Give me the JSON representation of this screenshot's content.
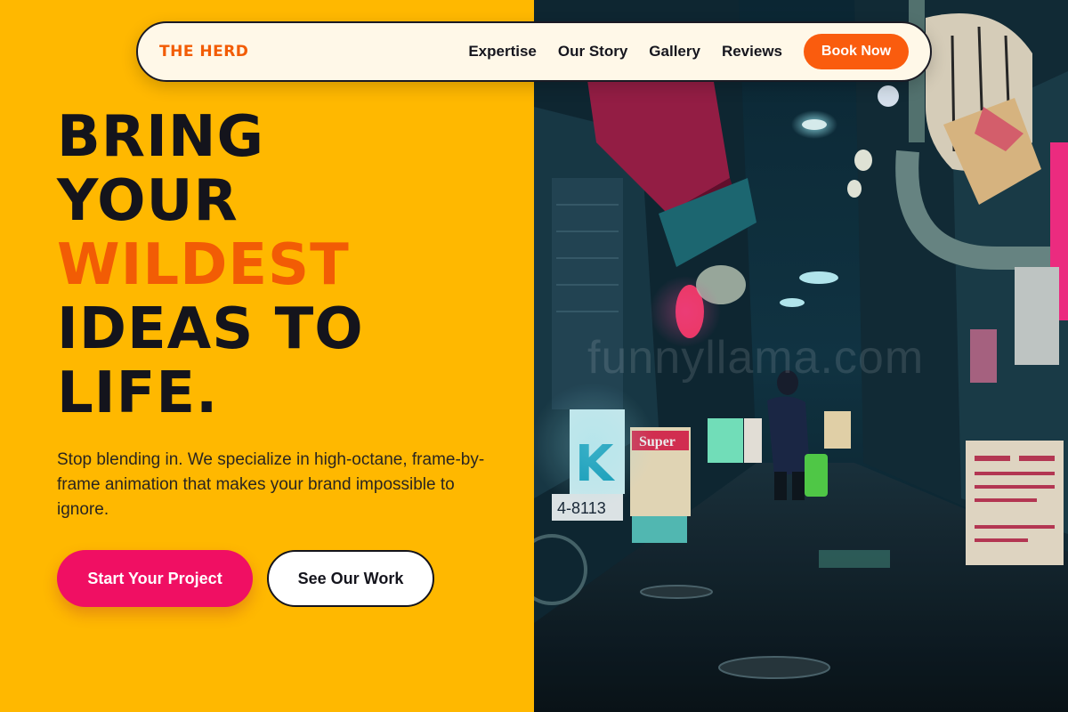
{
  "nav": {
    "brand": "THE HERD",
    "links": [
      "Expertise",
      "Our Story",
      "Gallery",
      "Reviews"
    ],
    "cta": "Book Now"
  },
  "hero": {
    "headline_lines": [
      "BRING",
      "YOUR",
      "WILDEST",
      "IDEAS TO",
      "LIFE."
    ],
    "accent_line_index": 2,
    "subtext": "Stop blending in. We specialize in high-octane, frame-by-frame animation that makes your brand impossible to ignore.",
    "primary_button": "Start Your Project",
    "secondary_button": "See Our Work"
  },
  "image": {
    "watermark": "funnyllama.com",
    "signs": {
      "super_sign": "Super",
      "k_sign": "K",
      "phone_number": "4-8113"
    }
  },
  "colors": {
    "background": "#FFB800",
    "accent_orange": "#F25C05",
    "cta_pink": "#F00F63",
    "text_dark": "#14141c",
    "nav_bg": "#FFF8E8"
  }
}
